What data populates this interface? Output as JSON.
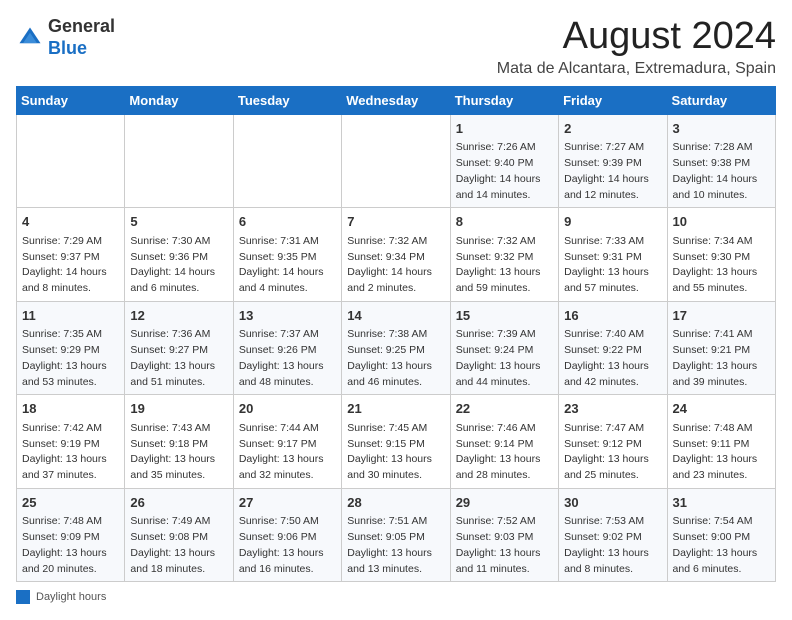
{
  "header": {
    "logo_line1": "General",
    "logo_line2": "Blue",
    "main_title": "August 2024",
    "subtitle": "Mata de Alcantara, Extremadura, Spain"
  },
  "calendar": {
    "days_of_week": [
      "Sunday",
      "Monday",
      "Tuesday",
      "Wednesday",
      "Thursday",
      "Friday",
      "Saturday"
    ],
    "weeks": [
      {
        "cells": [
          {
            "day": "",
            "info": ""
          },
          {
            "day": "",
            "info": ""
          },
          {
            "day": "",
            "info": ""
          },
          {
            "day": "",
            "info": ""
          },
          {
            "day": "1",
            "info": "Sunrise: 7:26 AM\nSunset: 9:40 PM\nDaylight: 14 hours\nand 14 minutes."
          },
          {
            "day": "2",
            "info": "Sunrise: 7:27 AM\nSunset: 9:39 PM\nDaylight: 14 hours\nand 12 minutes."
          },
          {
            "day": "3",
            "info": "Sunrise: 7:28 AM\nSunset: 9:38 PM\nDaylight: 14 hours\nand 10 minutes."
          }
        ]
      },
      {
        "cells": [
          {
            "day": "4",
            "info": "Sunrise: 7:29 AM\nSunset: 9:37 PM\nDaylight: 14 hours\nand 8 minutes."
          },
          {
            "day": "5",
            "info": "Sunrise: 7:30 AM\nSunset: 9:36 PM\nDaylight: 14 hours\nand 6 minutes."
          },
          {
            "day": "6",
            "info": "Sunrise: 7:31 AM\nSunset: 9:35 PM\nDaylight: 14 hours\nand 4 minutes."
          },
          {
            "day": "7",
            "info": "Sunrise: 7:32 AM\nSunset: 9:34 PM\nDaylight: 14 hours\nand 2 minutes."
          },
          {
            "day": "8",
            "info": "Sunrise: 7:32 AM\nSunset: 9:32 PM\nDaylight: 13 hours\nand 59 minutes."
          },
          {
            "day": "9",
            "info": "Sunrise: 7:33 AM\nSunset: 9:31 PM\nDaylight: 13 hours\nand 57 minutes."
          },
          {
            "day": "10",
            "info": "Sunrise: 7:34 AM\nSunset: 9:30 PM\nDaylight: 13 hours\nand 55 minutes."
          }
        ]
      },
      {
        "cells": [
          {
            "day": "11",
            "info": "Sunrise: 7:35 AM\nSunset: 9:29 PM\nDaylight: 13 hours\nand 53 minutes."
          },
          {
            "day": "12",
            "info": "Sunrise: 7:36 AM\nSunset: 9:27 PM\nDaylight: 13 hours\nand 51 minutes."
          },
          {
            "day": "13",
            "info": "Sunrise: 7:37 AM\nSunset: 9:26 PM\nDaylight: 13 hours\nand 48 minutes."
          },
          {
            "day": "14",
            "info": "Sunrise: 7:38 AM\nSunset: 9:25 PM\nDaylight: 13 hours\nand 46 minutes."
          },
          {
            "day": "15",
            "info": "Sunrise: 7:39 AM\nSunset: 9:24 PM\nDaylight: 13 hours\nand 44 minutes."
          },
          {
            "day": "16",
            "info": "Sunrise: 7:40 AM\nSunset: 9:22 PM\nDaylight: 13 hours\nand 42 minutes."
          },
          {
            "day": "17",
            "info": "Sunrise: 7:41 AM\nSunset: 9:21 PM\nDaylight: 13 hours\nand 39 minutes."
          }
        ]
      },
      {
        "cells": [
          {
            "day": "18",
            "info": "Sunrise: 7:42 AM\nSunset: 9:19 PM\nDaylight: 13 hours\nand 37 minutes."
          },
          {
            "day": "19",
            "info": "Sunrise: 7:43 AM\nSunset: 9:18 PM\nDaylight: 13 hours\nand 35 minutes."
          },
          {
            "day": "20",
            "info": "Sunrise: 7:44 AM\nSunset: 9:17 PM\nDaylight: 13 hours\nand 32 minutes."
          },
          {
            "day": "21",
            "info": "Sunrise: 7:45 AM\nSunset: 9:15 PM\nDaylight: 13 hours\nand 30 minutes."
          },
          {
            "day": "22",
            "info": "Sunrise: 7:46 AM\nSunset: 9:14 PM\nDaylight: 13 hours\nand 28 minutes."
          },
          {
            "day": "23",
            "info": "Sunrise: 7:47 AM\nSunset: 9:12 PM\nDaylight: 13 hours\nand 25 minutes."
          },
          {
            "day": "24",
            "info": "Sunrise: 7:48 AM\nSunset: 9:11 PM\nDaylight: 13 hours\nand 23 minutes."
          }
        ]
      },
      {
        "cells": [
          {
            "day": "25",
            "info": "Sunrise: 7:48 AM\nSunset: 9:09 PM\nDaylight: 13 hours\nand 20 minutes."
          },
          {
            "day": "26",
            "info": "Sunrise: 7:49 AM\nSunset: 9:08 PM\nDaylight: 13 hours\nand 18 minutes."
          },
          {
            "day": "27",
            "info": "Sunrise: 7:50 AM\nSunset: 9:06 PM\nDaylight: 13 hours\nand 16 minutes."
          },
          {
            "day": "28",
            "info": "Sunrise: 7:51 AM\nSunset: 9:05 PM\nDaylight: 13 hours\nand 13 minutes."
          },
          {
            "day": "29",
            "info": "Sunrise: 7:52 AM\nSunset: 9:03 PM\nDaylight: 13 hours\nand 11 minutes."
          },
          {
            "day": "30",
            "info": "Sunrise: 7:53 AM\nSunset: 9:02 PM\nDaylight: 13 hours\nand 8 minutes."
          },
          {
            "day": "31",
            "info": "Sunrise: 7:54 AM\nSunset: 9:00 PM\nDaylight: 13 hours\nand 6 minutes."
          }
        ]
      }
    ]
  },
  "legend": {
    "label": "Daylight hours"
  }
}
